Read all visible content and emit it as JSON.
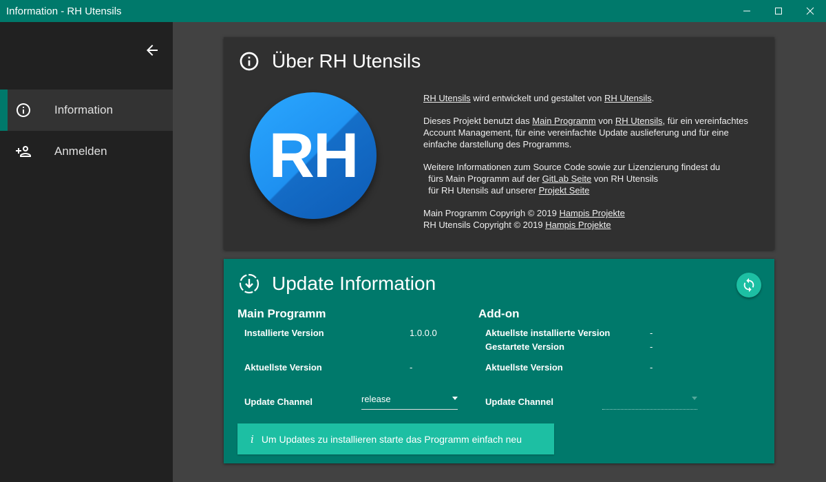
{
  "window": {
    "title": "Information - RH Utensils"
  },
  "sidebar": {
    "items": [
      {
        "label": "Information",
        "icon": "info-icon",
        "active": true
      },
      {
        "label": "Anmelden",
        "icon": "person-add-icon",
        "active": false
      }
    ]
  },
  "about": {
    "title": "Über RH Utensils",
    "logo_text": "RH",
    "p1": {
      "link1": "RH Utensils",
      "text1": " wird entwickelt und gestaltet von ",
      "link2": "RH Utensils",
      "text2": "."
    },
    "p2": {
      "text1": "Dieses Projekt benutzt das ",
      "link1": "Main Programm",
      "text2": " von ",
      "link2": "RH Utensils",
      "text3": ", für ein vereinfachtes Account Management, für eine vereinfachte Update auslieferung und für eine einfache darstellung des Programms."
    },
    "p3": {
      "line1": "Weitere Informationen zum Source Code sowie zur Lizenzierung findest du",
      "line2_a": "  fürs Main Programm auf der ",
      "line2_link": "GitLab Seite",
      "line2_b": " von RH Utensils",
      "line3_a": "  für RH Utensils auf unserer ",
      "line3_link": "Projekt Seite"
    },
    "p4": {
      "line1_a": "Main Programm Copyrigh © 2019 ",
      "line1_link": "Hampis Projekte",
      "line2_a": "RH Utensils Copyright © 2019 ",
      "line2_link": "Hampis Projekte"
    }
  },
  "update": {
    "title": "Update Information",
    "main": {
      "heading": "Main Programm",
      "installed_label": "Installierte Version",
      "installed_value": "1.0.0.0",
      "latest_label": "Aktuellste Version",
      "latest_value": "-",
      "channel_label": "Update Channel",
      "channel_value": "release"
    },
    "addon": {
      "heading": "Add-on",
      "installed_label": "Aktuellste installierte Version",
      "installed_value": "-",
      "started_label": "Gestartete Version",
      "started_value": "-",
      "latest_label": "Aktuellste Version",
      "latest_value": "-",
      "channel_label": "Update Channel",
      "channel_value": ""
    },
    "info_icon": "i",
    "info_text": "Um Updates zu installieren starte das Programm einfach neu"
  },
  "colors": {
    "accent": "#00796b",
    "accent_light": "#1dbfa3",
    "logo_blue": "#1e90f0",
    "sidebar_bg": "#212121",
    "card_bg": "#303030",
    "page_bg": "#424242"
  }
}
